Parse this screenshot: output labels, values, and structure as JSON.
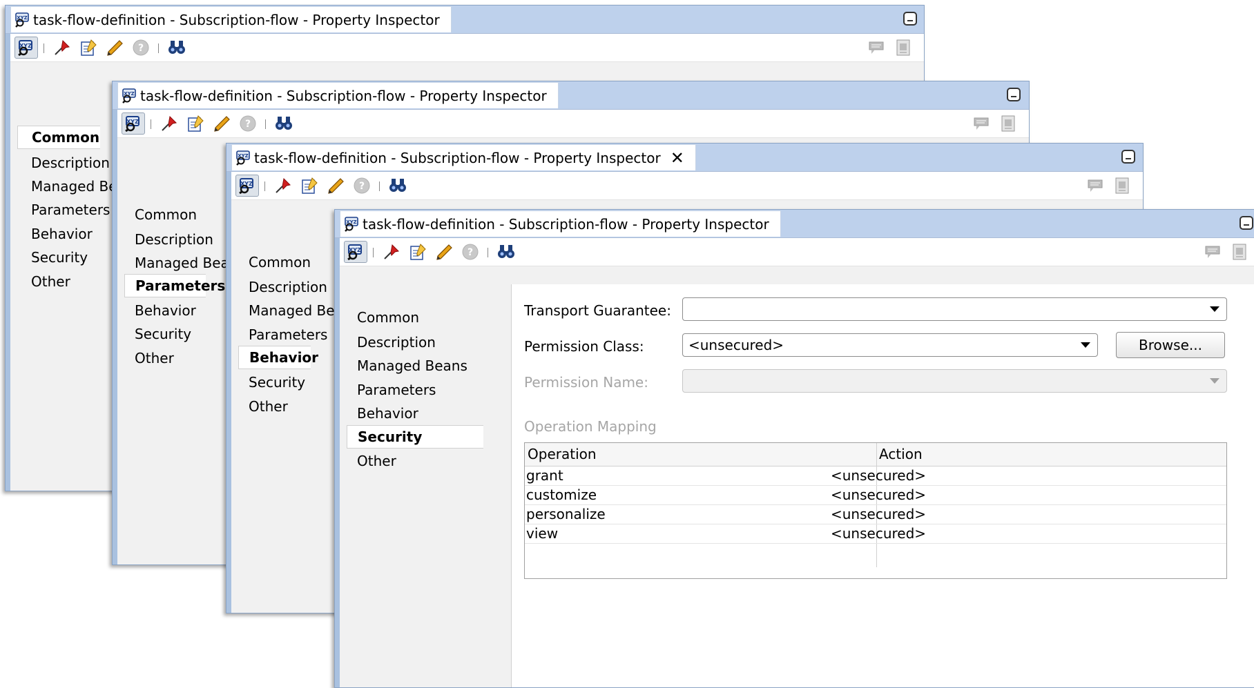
{
  "panel_title": "task-flow-definition - Subscription-flow - Property Inspector",
  "nav_items": [
    "Common",
    "Description",
    "Managed Beans",
    "Parameters",
    "Behavior",
    "Security",
    "Other"
  ],
  "panels": [
    {
      "active_section": "Common",
      "nav_labels": [
        "Common",
        "Description",
        "Managed Be",
        "Parameters",
        "Behavior",
        "Security",
        "Other"
      ]
    },
    {
      "active_section": "Parameters",
      "nav_labels": [
        "Common",
        "Description",
        "Managed Bea",
        "Parameters",
        "Behavior",
        "Security",
        "Other"
      ]
    },
    {
      "active_section": "Behavior",
      "nav_labels": [
        "Common",
        "Description",
        "Managed Be",
        "Parameters",
        "Behavior",
        "Security",
        "Other"
      ],
      "close_glyph": "✕"
    },
    {
      "active_section": "Security",
      "nav_labels": [
        "Common",
        "Description",
        "Managed Beans",
        "Parameters",
        "Behavior",
        "Security",
        "Other"
      ]
    }
  ],
  "toolbar_icons": [
    "structure-icon",
    "pin-icon",
    "edit-icon",
    "pencil-icon",
    "help-icon",
    "find-icon",
    "comment-icon",
    "page-icon"
  ],
  "security_form": {
    "transport_label": "Transport Guarantee:",
    "transport_value": "",
    "permission_class_label": "Permission Class:",
    "permission_class_value": "<unsecured>",
    "browse_label": "Browse...",
    "permission_name_label": "Permission Name:",
    "permission_name_value": "",
    "operation_mapping_label": "Operation Mapping",
    "columns": [
      "Operation",
      "Action"
    ],
    "rows": [
      {
        "operation": "grant",
        "action": "<unsecured>"
      },
      {
        "operation": "customize",
        "action": "<unsecured>"
      },
      {
        "operation": "personalize",
        "action": "<unsecured>"
      },
      {
        "operation": "view",
        "action": "<unsecured>"
      }
    ]
  },
  "colors": {
    "titlebar": "#bed1ec",
    "panel_bg": "#f1f1f1",
    "border": "#8aa3c4",
    "pin_red": "#d02020"
  }
}
